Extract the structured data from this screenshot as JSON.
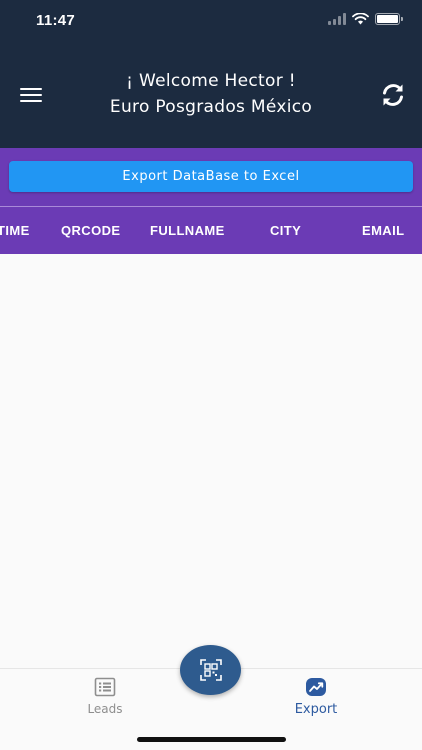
{
  "status_bar": {
    "time": "11:47"
  },
  "header": {
    "title_line1": "¡ Welcome Hector !",
    "title_line2": "Euro Posgrados México",
    "menu_icon": "hamburger-menu-icon",
    "refresh_icon": "sync-icon"
  },
  "toolbar": {
    "export_label": "Export DataBase to Excel"
  },
  "table": {
    "columns": [
      "TIME",
      "QRCODE",
      "FULLNAME",
      "CITY",
      "EMAIL"
    ]
  },
  "tabs": [
    {
      "label": "Leads",
      "icon": "list-icon",
      "active": false
    },
    {
      "label": "Export",
      "icon": "chart-trend-icon",
      "active": true
    }
  ],
  "fab": {
    "icon": "qr-scan-icon"
  },
  "colors": {
    "header_bg": "#1c2b40",
    "toolbar_bg": "#6b3bb5",
    "button_bg": "#2196f3",
    "fab_bg": "#2e5b8e",
    "active_tab": "#2d5aa0"
  }
}
